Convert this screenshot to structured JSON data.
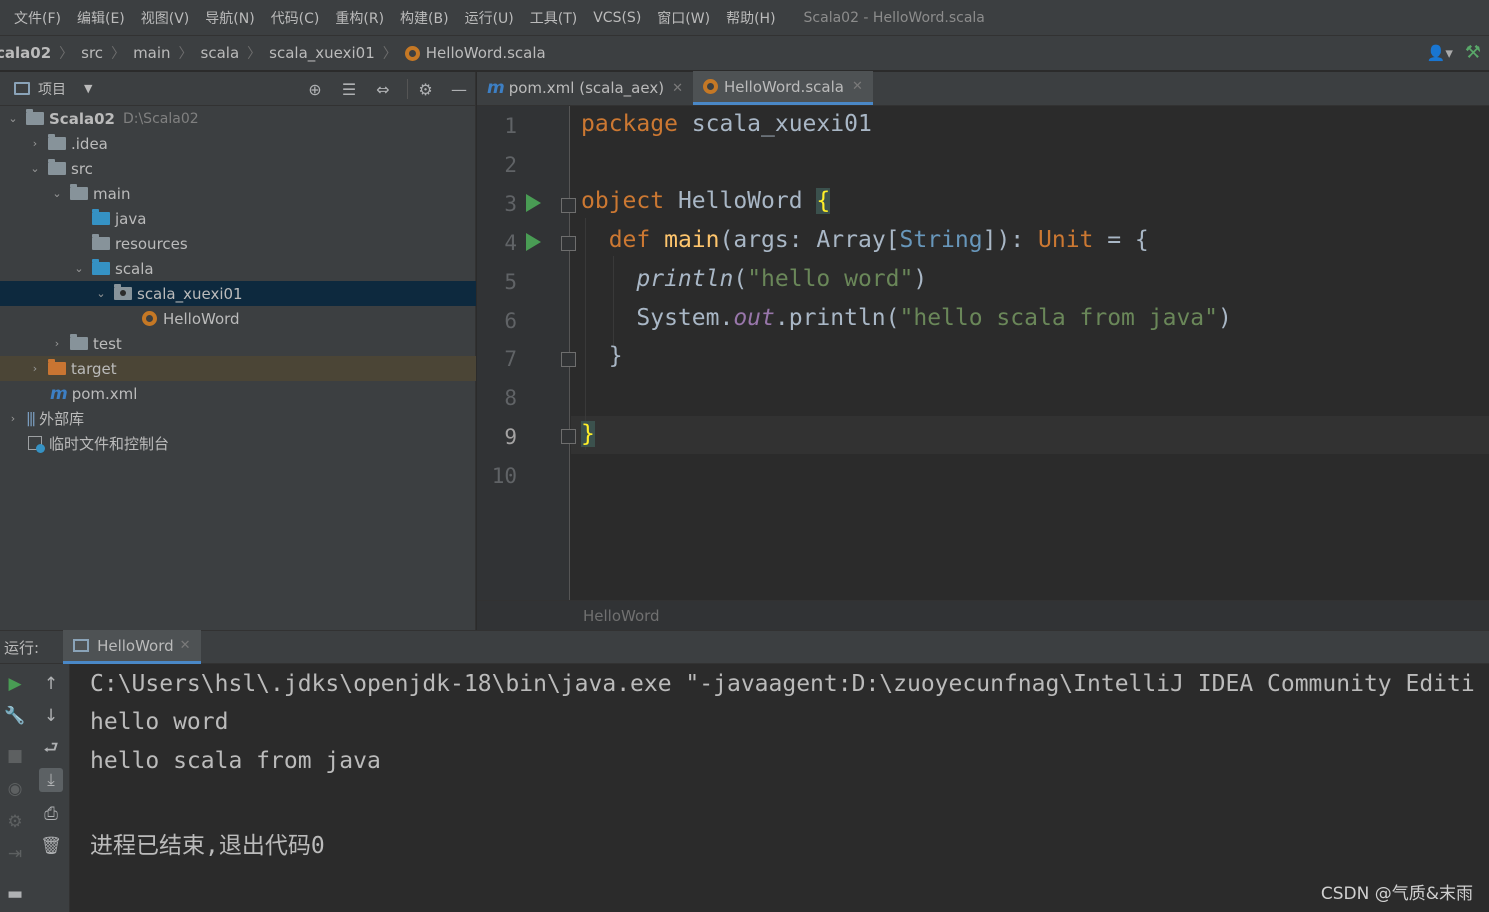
{
  "menu": {
    "items": [
      "文件(F)",
      "编辑(E)",
      "视图(V)",
      "导航(N)",
      "代码(C)",
      "重构(R)",
      "构建(B)",
      "运行(U)",
      "工具(T)",
      "VCS(S)",
      "窗口(W)",
      "帮助(H)"
    ],
    "window_title": "Scala02 - HelloWord.scala"
  },
  "breadcrumb": [
    "cala02",
    "src",
    "main",
    "scala",
    "scala_xuexi01",
    "HelloWord.scala"
  ],
  "project_panel": {
    "title": "项目",
    "tree": [
      {
        "label": "Scala02",
        "sub": "D:\\Scala02"
      },
      {
        "label": ".idea"
      },
      {
        "label": "src"
      },
      {
        "label": "main"
      },
      {
        "label": "java"
      },
      {
        "label": "resources"
      },
      {
        "label": "scala"
      },
      {
        "label": "scala_xuexi01"
      },
      {
        "label": "HelloWord"
      },
      {
        "label": "test"
      },
      {
        "label": "target"
      },
      {
        "label": "pom.xml"
      },
      {
        "label": "外部库"
      },
      {
        "label": "临时文件和控制台"
      }
    ]
  },
  "editor": {
    "tabs": [
      {
        "label": "pom.xml (scala_aex)"
      },
      {
        "label": "HelloWord.scala"
      }
    ],
    "line_numbers": [
      "1",
      "2",
      "3",
      "4",
      "5",
      "6",
      "7",
      "8",
      "9",
      "10"
    ],
    "code": {
      "l1_kw": "package",
      "l1_rest": " scala_xuexi01",
      "l3_kw": "object",
      "l3_name": " HelloWord ",
      "l3_brace": "{",
      "l4_kw": "def",
      "l4_fn": "main",
      "l4_a": "(args: Array[",
      "l4_type": "String",
      "l4_b": "]): ",
      "l4_unit": "Unit",
      "l4_c": " = {",
      "l5_fn": "println",
      "l5_a": "(",
      "l5_str": "\"hello word\"",
      "l5_b": ")",
      "l6_a": "System.",
      "l6_field": "out",
      "l6_b": ".println(",
      "l6_str": "\"hello scala from java\"",
      "l6_c": ")",
      "l7": "}",
      "l9": "}"
    },
    "footer_breadcrumb": "HelloWord"
  },
  "run_panel": {
    "label": "运行:",
    "tab": "HelloWord",
    "console": [
      "C:\\Users\\hsl\\.jdks\\openjdk-18\\bin\\java.exe \"-javaagent:D:\\zuoyecunfnag\\IntelliJ IDEA Community Editi",
      "hello word",
      "hello scala from java",
      "",
      "进程已结束,退出代码0"
    ]
  },
  "watermark": "CSDN @气质&末雨"
}
